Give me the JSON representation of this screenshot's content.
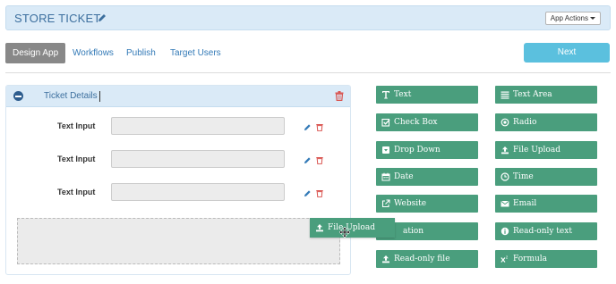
{
  "header": {
    "title": "STORE TICKET",
    "app_actions_label": "App Actions"
  },
  "tabs": [
    {
      "label": "Design App",
      "active": true
    },
    {
      "label": "Workflows"
    },
    {
      "label": "Publish"
    },
    {
      "label": "Target Users"
    }
  ],
  "next_label": "Next",
  "section": {
    "title": "Ticket Details",
    "fields": [
      {
        "label": "Text Input",
        "value": ""
      },
      {
        "label": "Text Input",
        "value": ""
      },
      {
        "label": "Text Input",
        "value": ""
      }
    ]
  },
  "palette": {
    "items": [
      {
        "label": "Text",
        "icon": "text-icon"
      },
      {
        "label": "Text Area",
        "icon": "text-area-icon"
      },
      {
        "label": "Check Box",
        "icon": "checkbox-icon"
      },
      {
        "label": "Radio",
        "icon": "radio-icon"
      },
      {
        "label": "Drop Down",
        "icon": "dropdown-icon"
      },
      {
        "label": "File Upload",
        "icon": "upload-icon"
      },
      {
        "label": "Date",
        "icon": "calendar-icon"
      },
      {
        "label": "Time",
        "icon": "clock-icon"
      },
      {
        "label": "Website",
        "icon": "external-link-icon"
      },
      {
        "label": "Email",
        "icon": "envelope-icon"
      },
      {
        "label": "ation",
        "icon": "location-icon"
      },
      {
        "label": "Read-only text",
        "icon": "info-icon"
      },
      {
        "label": "Read-only file",
        "icon": "upload-icon"
      },
      {
        "label": "Formula",
        "icon": "superscript-icon"
      }
    ]
  },
  "drag_ghost": {
    "label": "File Upload",
    "icon": "upload-icon"
  },
  "colors": {
    "header_bg": "#daeaf7",
    "title_color": "#3c6f9e",
    "palette_green": "#4a9e7d",
    "next_blue": "#5bc0de",
    "delete_red": "#d9534f",
    "edit_blue": "#337ab7"
  }
}
